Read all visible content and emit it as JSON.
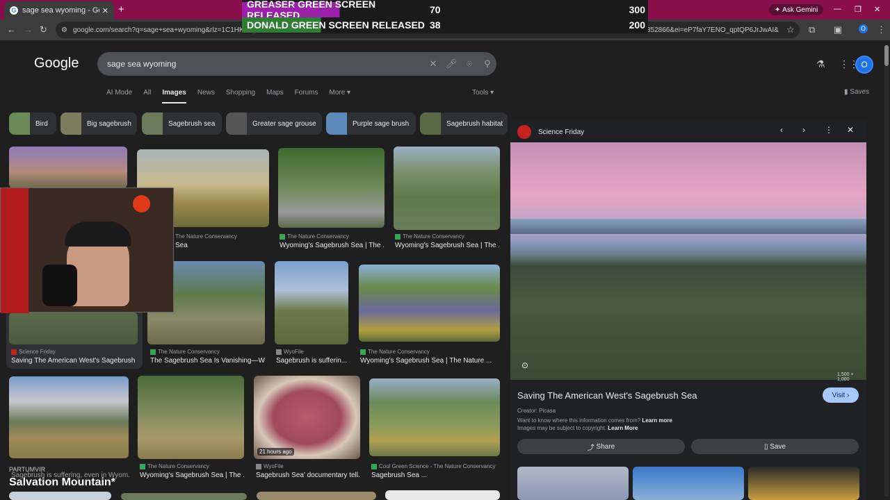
{
  "browser": {
    "tab_title": "sage sea wyoming - Google Se",
    "tab_close": "✕",
    "new_tab": "+",
    "ask_gemini": "Ask Gemini",
    "url": "google.com/search?q=sage+sea+wyoming&rlz=1C1HKFL_",
    "url_tail": "352866&ei=eP7faY7ENO_qptQP6JrJwAI&ve..."
  },
  "stream_overlay": {
    "rows": [
      {
        "name": "GREASER GREEN SCREEN RELEASED",
        "a": "70",
        "b": "300"
      },
      {
        "name": "DONALD GREEN SCREEN RELEASED",
        "a": "38",
        "b": "200"
      }
    ],
    "bottom_label": "PARTUMVIR",
    "bottom_title": "Salvation Mountain*"
  },
  "google": {
    "logo": "Google",
    "query": "sage sea wyoming",
    "nav_tabs": [
      "AI Mode",
      "All",
      "Images",
      "News",
      "Shopping",
      "Maps",
      "Forums",
      "More ▾"
    ],
    "tools": "Tools ▾",
    "saves": "Saves",
    "avatar_letter": "O"
  },
  "chips": [
    "Bird",
    "Big sagebrush",
    "Sagebrush sea",
    "Greater sage grouse",
    "Purple sage brush",
    "Sagebrush habitat"
  ],
  "results": [
    {
      "source": "The Nature Conservancy",
      "title": "Wyoming's Sagebrush Sea | The ..."
    },
    {
      "source": "The Nature Conservancy",
      "title": "Wyoming's Sagebrush Sea | The ..."
    },
    {
      "source": "Science Friday",
      "title": "Saving The American West's Sagebrush ..."
    },
    {
      "source": "The Nature Conservancy",
      "title": "The Sagebrush Sea Is Vanishing—W..."
    },
    {
      "source": "WyoFile",
      "title": "Sagebrush is sufferin..."
    },
    {
      "source": "The Nature Conservancy",
      "title": "Wyoming's Sagebrush Sea | The Nature ..."
    },
    {
      "source": "The Nature Conservancy",
      "title": "Wyoming's Sagebrush Sea | The ..."
    },
    {
      "source": "WyoFile",
      "title": "Sagebrush Sea' documentary tell..."
    },
    {
      "source": "Cool Green Science - The Nature Conservancy",
      "title": "Sagebrush Sea ..."
    }
  ],
  "time_badge": "21 hours ago",
  "partial_source": "The Nature Conservancy",
  "partial_title": "Sea",
  "bottom_left_caption": "Sagebrush is suffering, even in Wyom...",
  "panel": {
    "source": "Science Friday",
    "dims": "1,500 × 1,000",
    "title": "Saving The American West's Sagebrush Sea",
    "visit": "Visit ›",
    "creator": "Creator: Picasa",
    "info": "Want to know where this information comes from?",
    "info_link": "Learn more",
    "copyright": "Images may be subject to copyright.",
    "copyright_link": "Learn More",
    "share": "Share",
    "save": "Save"
  }
}
